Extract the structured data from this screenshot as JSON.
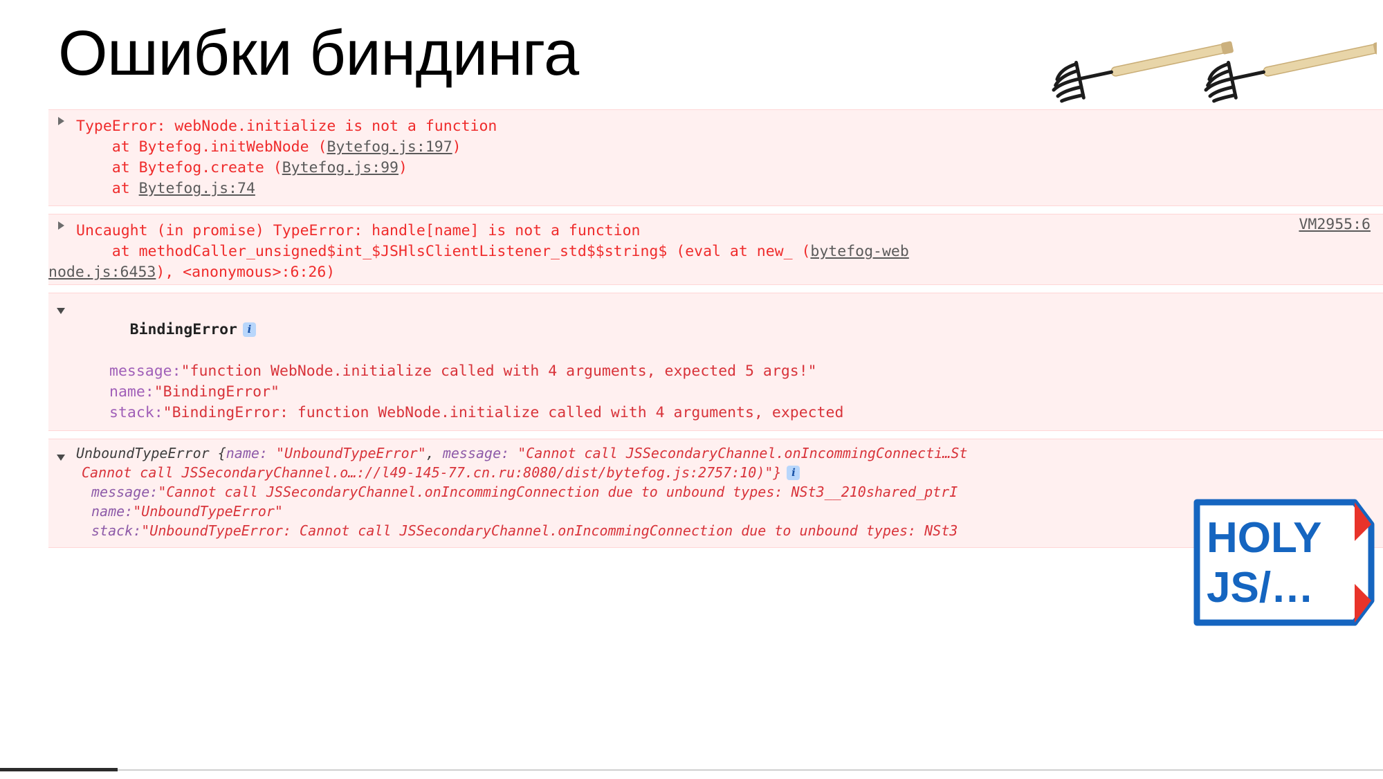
{
  "slide": {
    "title": "Ошибки биндинга",
    "decorations": {
      "rakes_illustration": "rakes-icon",
      "logo": "holyjs-logo",
      "logo_text_top": "HOLY",
      "logo_text_bottom": "JS/…"
    }
  },
  "console": {
    "blocks": [
      {
        "id": "typeerror",
        "expander": "collapsed-triangle-icon",
        "lines": [
          {
            "text": "TypeError: webNode.initialize is not a function"
          },
          {
            "text": "    at Bytefog.initWebNode (",
            "link": "Bytefog.js:197",
            "tail": ")"
          },
          {
            "text": "    at Bytefog.create (",
            "link": "Bytefog.js:99",
            "tail": ")"
          },
          {
            "text": "    at ",
            "link": "Bytefog.js:74",
            "tail": ""
          }
        ]
      },
      {
        "id": "uncaught",
        "expander": "collapsed-triangle-icon",
        "vm_link": "VM2955:6",
        "lines": [
          {
            "text": "Uncaught (in promise) TypeError: handle[name] is not a function"
          },
          {
            "text": "    at methodCaller_unsigned$int_$JSHlsClientListener_std$$string$ (eval at new_ (",
            "link": "bytefog-web",
            "tail": ""
          },
          {
            "link": "node.js:6453",
            "tail": "), <anonymous>:6:26)"
          }
        ]
      },
      {
        "id": "binding",
        "expander": "expanded-triangle-icon",
        "header": "BindingError",
        "badge": "i",
        "props": [
          {
            "key": "message:",
            "value": "\"function WebNode.initialize called with 4 arguments, expected 5 args!\""
          },
          {
            "key": "name:",
            "value": "\"BindingError\""
          },
          {
            "key": "stack:",
            "value": "\"BindingError: function WebNode.initialize called with 4 arguments, expected"
          }
        ]
      },
      {
        "id": "unbound",
        "expander": "expanded-triangle-icon",
        "preview_line_1_a": "UnboundTypeError {",
        "preview_line_1_key1": "name:",
        "preview_line_1_val1": " \"UnboundTypeError\"",
        "preview_line_1_sep": ", ",
        "preview_line_1_key2": "message:",
        "preview_line_1_val2": " \"Cannot call JSSecondaryChannel.onIncommingConnecti…St",
        "preview_line_2": "Cannot call JSSecondaryChannel.o…://l49-145-77.cn.ru:8080/dist/bytefog.js:2757:10)\"}",
        "badge": "i",
        "props": [
          {
            "key": "message:",
            "value": "\"Cannot call JSSecondaryChannel.onIncommingConnection due to unbound types: NSt3__210shared_ptrI"
          },
          {
            "key": "name:",
            "value": "\"UnboundTypeError\""
          },
          {
            "key": "stack:",
            "value": "\"UnboundTypeError: Cannot call JSSecondaryChannel.onIncommingConnection due to unbound types: NSt3"
          }
        ]
      }
    ]
  },
  "colors": {
    "error_text": "#ef2b2b",
    "error_bg": "#fff0f0",
    "error_border": "#ffd6d6",
    "link": "#5a5a5a",
    "prop_key": "#a05fb8",
    "prop_value": "#d8333a",
    "badge_bg": "#b8d6fb",
    "logo_blue": "#1565c0",
    "logo_red": "#e8332a"
  }
}
